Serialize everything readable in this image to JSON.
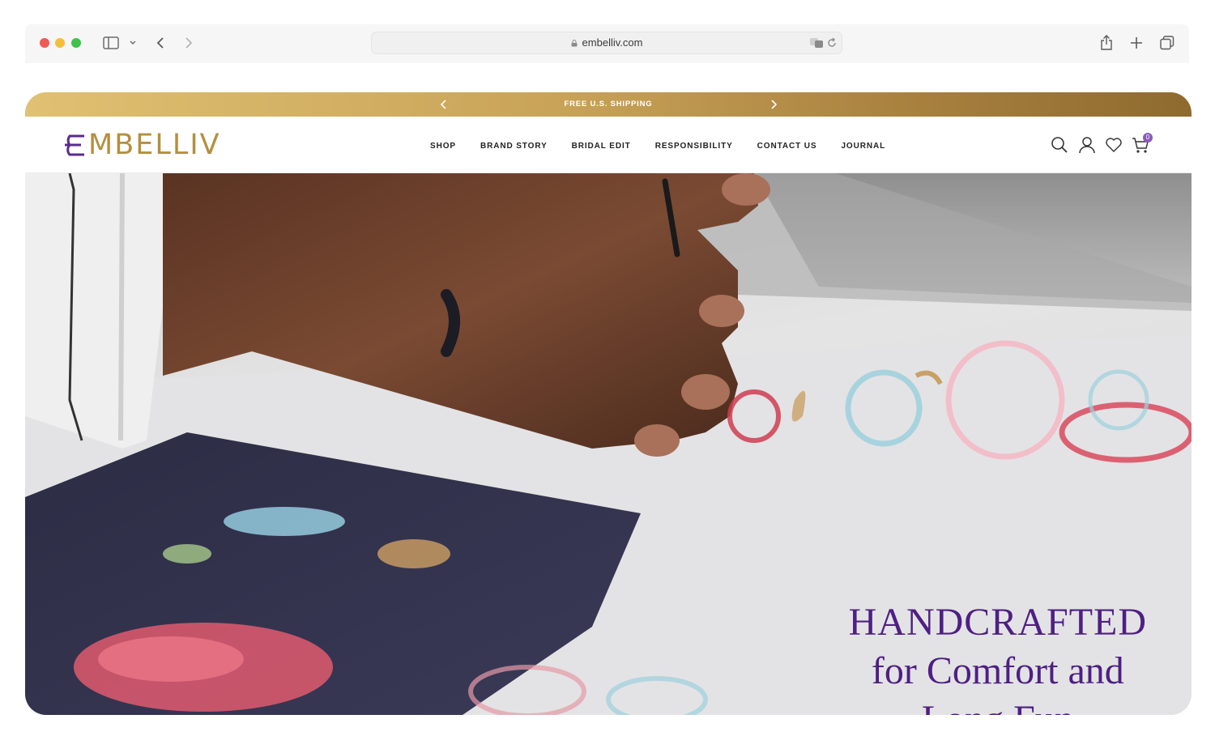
{
  "browser": {
    "url": "embelliv.com"
  },
  "site": {
    "announcement": "FREE U.S. SHIPPING",
    "logo_text": "MBELLIV",
    "nav": [
      {
        "label": "SHOP"
      },
      {
        "label": "BRAND STORY"
      },
      {
        "label": "BRIDAL EDIT"
      },
      {
        "label": "RESPONSIBILITY"
      },
      {
        "label": "CONTACT US"
      },
      {
        "label": "JOURNAL"
      }
    ],
    "cart_count": "0",
    "icons": [
      "search-icon",
      "account-icon",
      "wishlist-icon",
      "cart-icon"
    ],
    "colors": {
      "brand_gold": "#b48f3e",
      "brand_purple": "#4e1f84",
      "badge_purple": "#8a5bb8"
    }
  },
  "hero": {
    "line1": "HANDCRAFTED",
    "line2": "for Comfort and",
    "line3": "Long Fun"
  }
}
